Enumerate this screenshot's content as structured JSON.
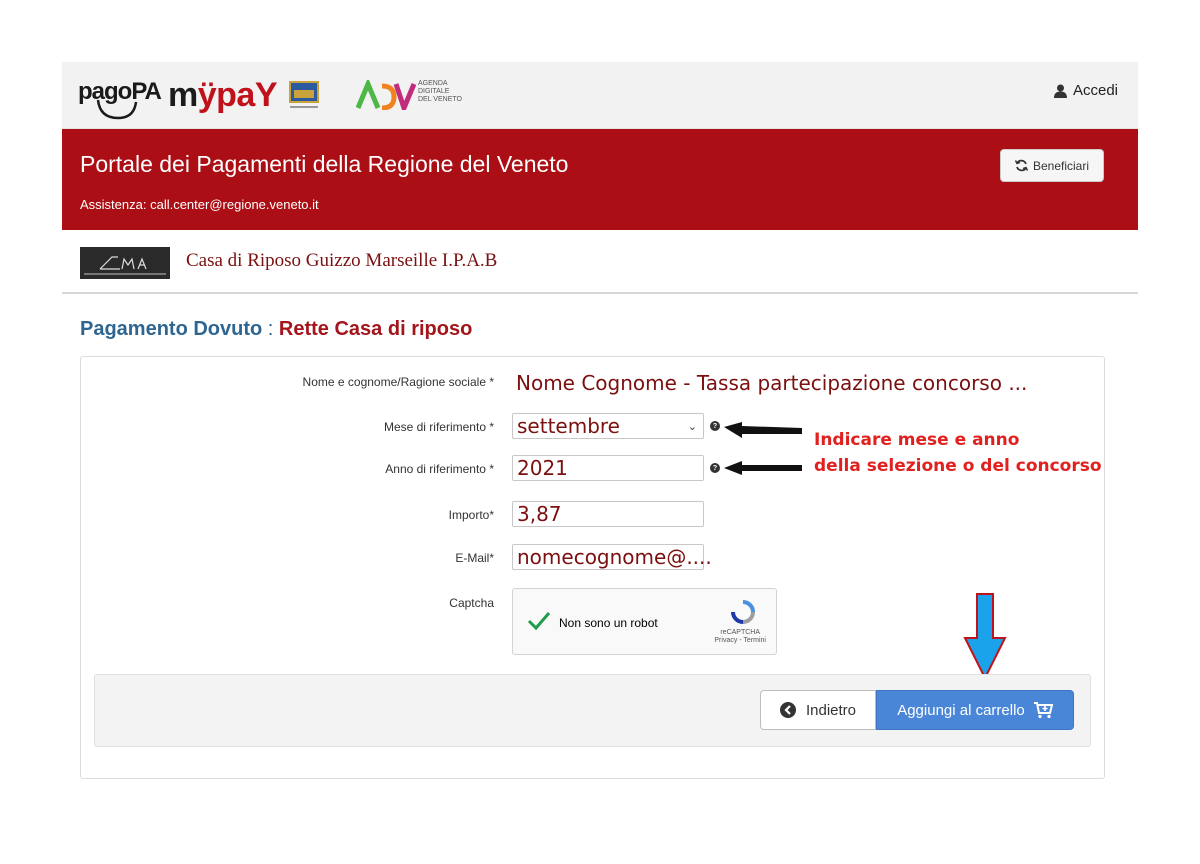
{
  "header": {
    "logos": [
      "pagoPA",
      "myPAY",
      "Regione del Veneto",
      "ADV"
    ],
    "pagopa_text": "pagoPA",
    "mypay_m": "m",
    "mypay_rest": "ÿpaY",
    "adv_text": "AGENDA\nDIGITALE\nDEL VENETO",
    "login_label": "Accedi",
    "login_icon": "user-icon"
  },
  "banner": {
    "title": "Portale dei Pagamenti della Regione del Veneto",
    "assistance": "Assistenza: call.center@regione.veneto.it",
    "beneficiari_label": "Beneficiari",
    "beneficiari_icon": "refresh-icon",
    "color": "#ab0f15"
  },
  "entity": {
    "name": "Casa di Riposo Guizzo Marseille I.P.A.B"
  },
  "page": {
    "heading_main": "Pagamento Dovuto",
    "heading_sep": " : ",
    "heading_service": "Rette Casa di riposo"
  },
  "form": {
    "name_label": "Nome e cognome/Ragione sociale *",
    "name_value": "Nome Cognome - Tassa partecipazione concorso ...",
    "month_label": "Mese di riferimento *",
    "month_value": "settembre",
    "year_label": "Anno di riferimento *",
    "year_value": "2021",
    "amount_label": "Importo*",
    "amount_value": "3,87",
    "email_label": "E-Mail*",
    "email_value": "nomecognome@....",
    "captcha_label": "Captcha",
    "captcha_text": "Non sono un robot",
    "captcha_brand": "reCAPTCHA",
    "captcha_links": "Privacy - Termini"
  },
  "annotation": {
    "line1": "Indicare mese e anno",
    "line2": "della selezione o del concorso",
    "color": "#e0211f"
  },
  "actions": {
    "back_label": "Indietro",
    "cart_label": "Aggiungi al carrello",
    "cart_color": "#4a86d8"
  }
}
